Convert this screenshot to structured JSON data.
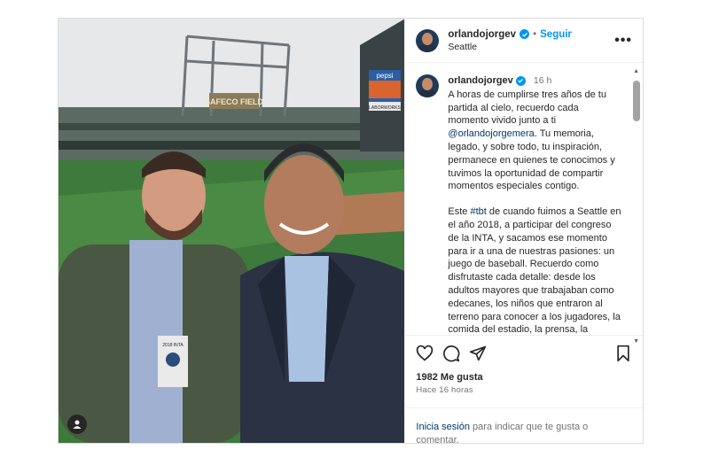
{
  "post": {
    "username": "orlandojorgev",
    "follow_label": "Seguir",
    "dot": "•",
    "location": "Seattle",
    "more_label": "•••",
    "time_ago_short": "16 h",
    "caption": {
      "p1_before": "A horas de cumplirse tres años de tu partida al cielo, recuerdo cada momento vivido junto a ti ",
      "p1_mention": "@orlandojorgemera",
      "p1_after": ". Tu memoria, legado, y sobre todo, tu inspiración, permanece en quienes te conocimos y tuvimos la oportunidad de compartir momentos especiales contigo.",
      "p2_before": "Este ",
      "p2_tag": "#tbt",
      "p2_after": " de cuando fuimos a Seattle en el año 2018, a participar del congreso de la INTA, y sacamos ese momento para ir a una de nuestras pasiones: un juego de baseball. Recuerdo como disfrutaste cada detalle: desde los adultos mayores que trabajaban como edecanes, los niños que entraron al terreno para conocer a los jugadores, la comida del estadio, la prensa, la emoción del juego, entre"
    },
    "likes": "1982 Me gusta",
    "time_ago_long": "Hace 16 horas",
    "login_link": "Inicia sesión",
    "login_text": " para indicar que te gusta o comentar."
  },
  "media": {
    "stadium_sign": "SAFECO FIELD",
    "scoreboard_brand": "pepsi",
    "scoreboard_ad": "LABORWORKS",
    "badge_text": "2018 INTA"
  },
  "icons": [
    "heart-icon",
    "comment-icon",
    "share-icon",
    "bookmark-icon",
    "verified-icon",
    "user-tag-icon",
    "scroll-arrow-up-icon",
    "scroll-arrow-down-icon"
  ]
}
